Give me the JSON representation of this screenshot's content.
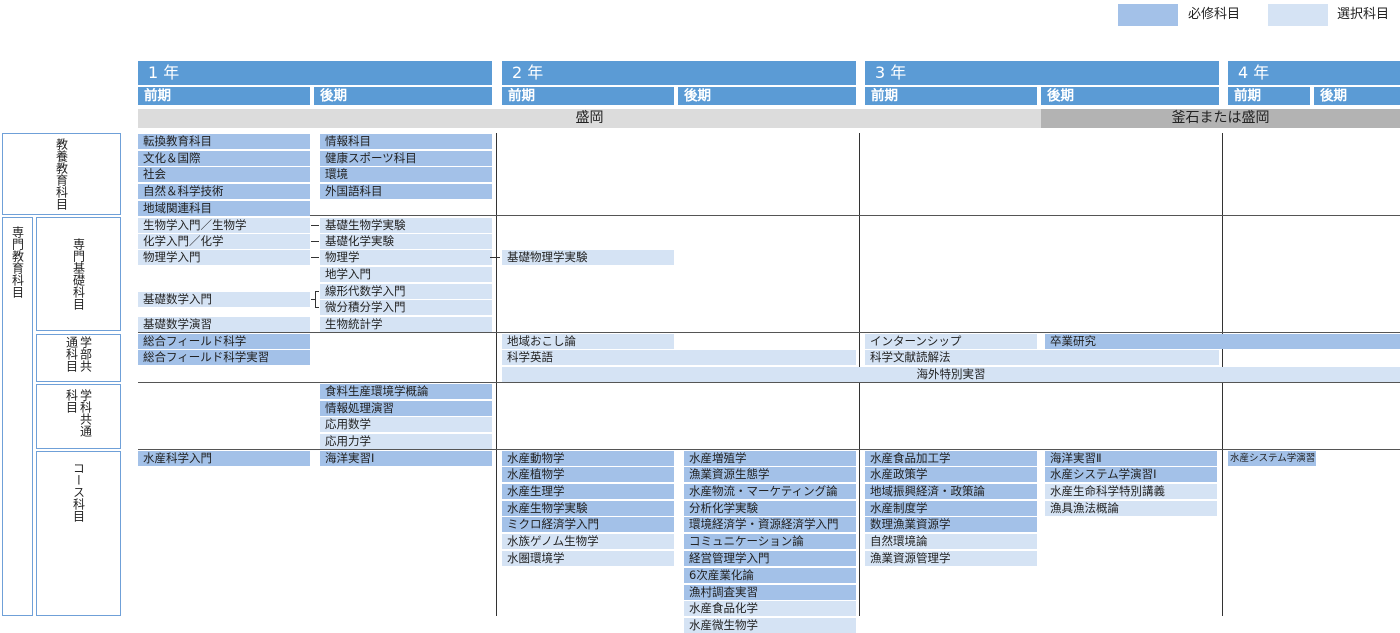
{
  "legend": {
    "required": "必修科目",
    "elective": "選択科目",
    "required_color": "#a3c1e8",
    "elective_color": "#d5e3f4"
  },
  "years": [
    "1 年",
    "2 年",
    "3 年",
    "4 年"
  ],
  "terms": {
    "first": "前期",
    "second": "後期"
  },
  "locations": {
    "morioka": "盛岡",
    "kamaishi": "釜石または盛岡"
  },
  "categories": {
    "general": "教養教育科目",
    "specialized": "専門教育科目",
    "basic": "専門基礎科目",
    "faculty_common": "学部共通科目",
    "dept_common": "学科共通科目",
    "course": "コース科目"
  },
  "rows": {
    "general": {
      "y1_first": [
        "転換教育科目",
        "文化＆国際",
        "社会",
        "自然＆科学技術",
        "地域関連科目"
      ],
      "y1_second": [
        "情報科目",
        "健康スポーツ科目",
        "環境",
        "外国語科目"
      ]
    },
    "basic": {
      "y1_first": [
        "生物学入門／生物学",
        "化学入門／化学",
        "物理学入門",
        "基礎数学入門",
        "基礎数学演習"
      ],
      "y1_second": [
        "基礎生物学実験",
        "基礎化学実験",
        "物理学",
        "地学入門",
        "線形代数学入門",
        "微分積分学入門",
        "生物統計学"
      ],
      "y2_first": [
        "基礎物理学実験"
      ]
    },
    "faculty_common": {
      "y1_first": [
        "総合フィールド科学",
        "総合フィールド科学実習"
      ],
      "y2_first": [
        "地域おこし論",
        "科学英語"
      ],
      "y3_first": [
        "インターンシップ",
        "科学文献読解法"
      ],
      "y3_second": [
        "卒業研究"
      ],
      "overseas": "海外特別実習"
    },
    "dept_common": {
      "y1_second": [
        "食料生産環境学概論",
        "情報処理演習",
        "応用数学",
        "応用力学"
      ]
    },
    "course": {
      "y1_first": [
        "水産科学入門"
      ],
      "y1_second": [
        "海洋実習Ⅰ"
      ],
      "y2_first": [
        "水産動物学",
        "水産植物学",
        "水産生理学",
        "水産生物学実験",
        "ミクロ経済学入門",
        "水族ゲノム生物学",
        "水圏環境学"
      ],
      "y2_second": [
        "水産増殖学",
        "漁業資源生態学",
        "水産物流・マーケティング論",
        "分析化学実験",
        "環境経済学・資源経済学入門",
        "コミュニケーション論",
        "経営管理学入門",
        "6次産業化論",
        "漁村調査実習",
        "水産食品化学",
        "水産微生物学"
      ],
      "y3_first": [
        "水産食品加工学",
        "水産政策学",
        "地域振興経済・政策論",
        "水産制度学",
        "数理漁業資源学",
        "自然環境論",
        "漁業資源管理学"
      ],
      "y3_second": [
        "海洋実習Ⅱ",
        "水産システム学演習Ⅰ",
        "水産生命科学特別講義",
        "漁具漁法概論"
      ],
      "y4_first": [
        "水産システム学演習Ⅱ"
      ]
    }
  }
}
